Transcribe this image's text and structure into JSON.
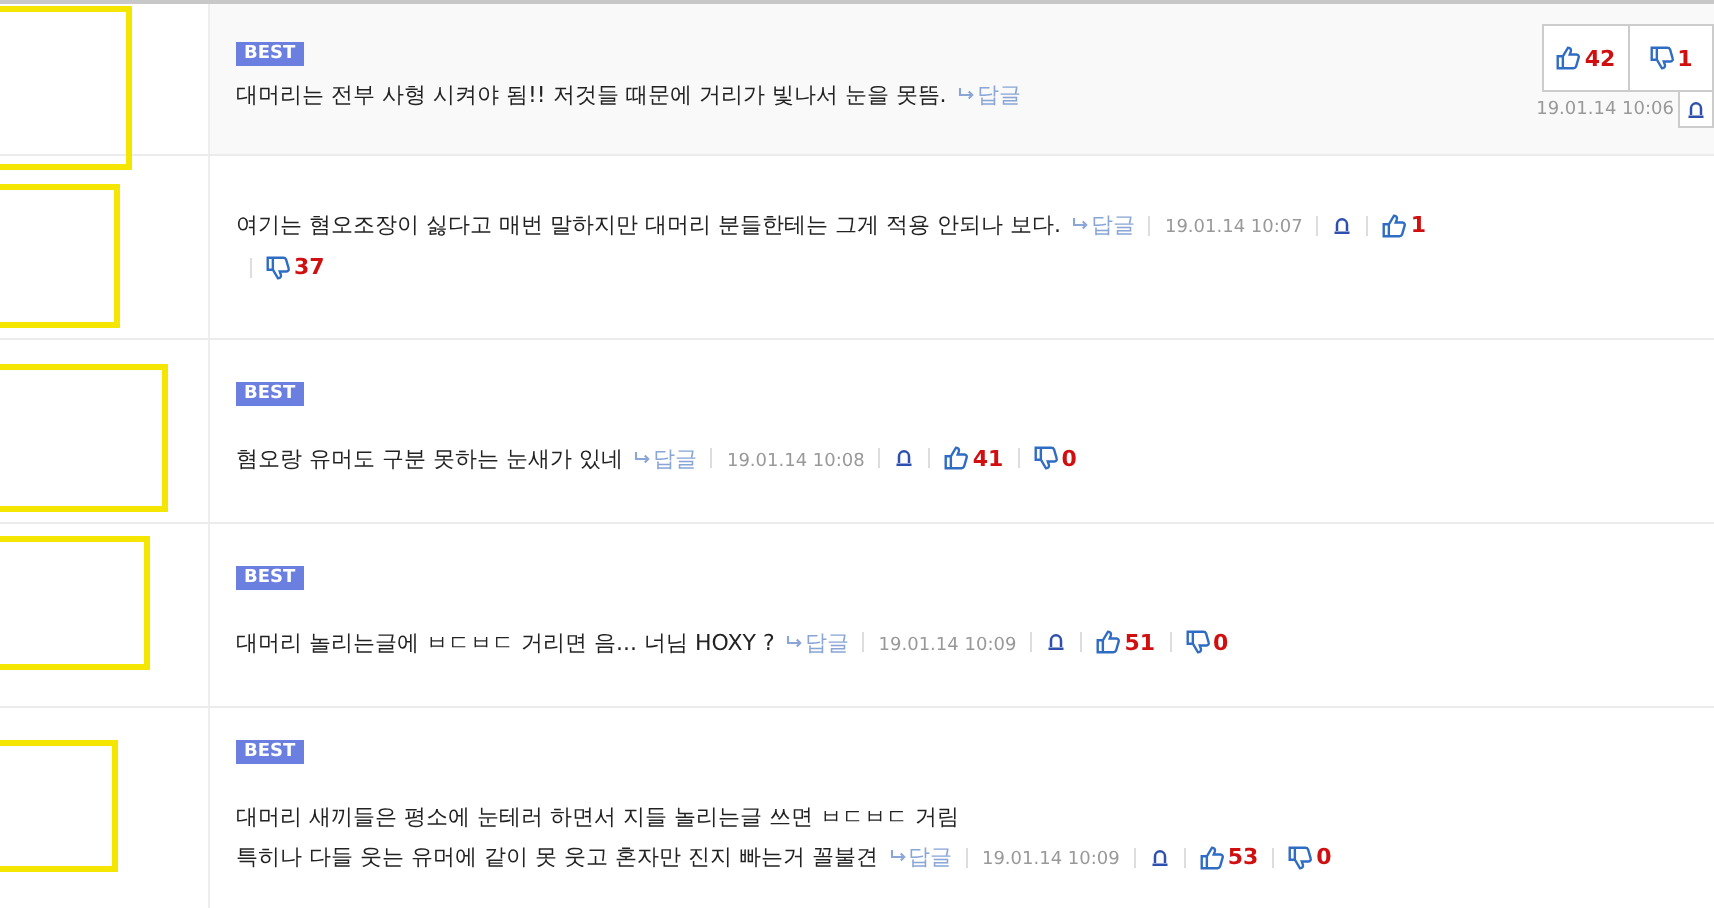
{
  "comments": [
    {
      "kind": "boxed",
      "badge": "BEST",
      "lines": [
        "대머리는 전부 사형 시켜야 됨!! 저것들 때문에 거리가 빛나서 눈을 못뜸."
      ],
      "reply": "답글",
      "time": "19.01.14 10:06",
      "likes": "42",
      "dislikes": "1"
    },
    {
      "kind": "inline",
      "lines": [
        "여기는 혐오조장이 싫다고 매번 말하지만 대머리 분들한테는 그게 적용 안되나 보다."
      ],
      "reply": "답글",
      "time": "19.01.14 10:07",
      "likes": "1",
      "dislikes": "37"
    },
    {
      "kind": "inline",
      "badge": "BEST",
      "lines": [
        "혐오랑 유머도 구분 못하는 눈새가 있네"
      ],
      "reply": "답글",
      "time": "19.01.14 10:08",
      "likes": "41",
      "dislikes": "0"
    },
    {
      "kind": "inline",
      "badge": "BEST",
      "lines": [
        "대머리 놀리는글에 ㅂㄷㅂㄷ 거리면 음... 너님 HOXY ?"
      ],
      "reply": "답글",
      "time": "19.01.14 10:09",
      "likes": "51",
      "dislikes": "0"
    },
    {
      "kind": "inline",
      "badge": "BEST",
      "lines": [
        "대머리 새끼들은 평소에 눈테러 하면서 지들 놀리는글 쓰면 ㅂㄷㅂㄷ 거림",
        "특히나 다들 웃는 유머에 같이 못 웃고 혼자만 진지 빠는거 꼴불견"
      ],
      "reply": "답글",
      "time": "19.01.14 10:09",
      "likes": "53",
      "dislikes": "0"
    }
  ]
}
